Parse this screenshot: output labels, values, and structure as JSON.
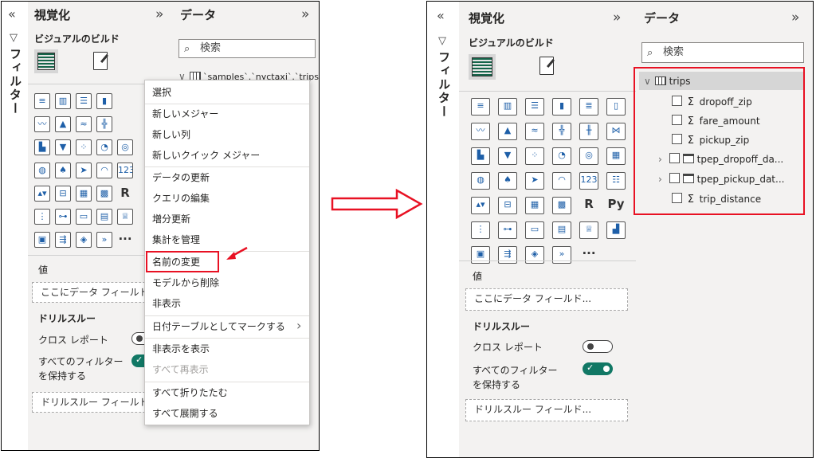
{
  "left_shot": {
    "collapse_icon": "«",
    "filter_vertical_label": "フィルター",
    "filter_icon": "funnel-icon",
    "visual_pane": {
      "title": "視覚化",
      "expand_icon": "»",
      "build_label": "ビジュアルのビルド",
      "values_label": "値",
      "values_placeholder": "ここにデータ フィールド",
      "drillthrough_label": "ドリルスルー",
      "cross_report_label": "クロス レポート",
      "keep_filters_line1": "すべてのフィルター",
      "keep_filters_line2": "を保持する",
      "drill_fields_placeholder": "ドリルスルー フィールド"
    },
    "data_pane": {
      "title": "データ",
      "expand_icon": "»",
      "search_placeholder": "検索",
      "table_path": "`samples`.`nyctaxi`.`trips`"
    },
    "context_menu": {
      "items": [
        "選択",
        "新しいメジャー",
        "新しい列",
        "新しいクイック メジャー",
        "データの更新",
        "クエリの編集",
        "増分更新",
        "集計を管理",
        "名前の変更",
        "モデルから削除",
        "非表示",
        "日付テーブルとしてマークする",
        "非表示を表示",
        "すべて再表示",
        "すべて折りたたむ",
        "すべて展開する"
      ],
      "submenu_arrow": "›",
      "highlighted_item": "名前の変更",
      "highlight_color": "#e81123"
    }
  },
  "arrow": {
    "icon": "right-arrow-icon",
    "color": "#e81123"
  },
  "right_shot": {
    "collapse_icon": "«",
    "filter_vertical_label": "フィルター",
    "visual_pane": {
      "title": "視覚化",
      "expand_icon": "»",
      "build_label": "ビジュアルのビルド",
      "values_label": "値",
      "values_placeholder": "ここにデータ フィールド...",
      "drillthrough_label": "ドリルスルー",
      "cross_report_label": "クロス レポート",
      "keep_filters_line1": "すべてのフィルター",
      "keep_filters_line2": "を保持する",
      "drill_fields_placeholder": "ドリルスルー フィールド..."
    },
    "data_pane": {
      "title": "データ",
      "expand_icon": "»",
      "search_placeholder": "検索",
      "table_name": "trips",
      "fields": [
        {
          "name": "dropoff_zip",
          "kind": "sum"
        },
        {
          "name": "fare_amount",
          "kind": "sum"
        },
        {
          "name": "pickup_zip",
          "kind": "sum"
        },
        {
          "name": "tpep_dropoff_da...",
          "kind": "date"
        },
        {
          "name": "tpep_pickup_dat...",
          "kind": "date"
        },
        {
          "name": "trip_distance",
          "kind": "sum"
        }
      ]
    }
  },
  "colors": {
    "toggle_on": "#117865",
    "accent_red": "#e81123",
    "pane_bg": "#f3f2f1"
  },
  "visual_icons": [
    "stacked-bar-icon",
    "stacked-column-icon",
    "clustered-bar-icon",
    "clustered-column-icon",
    "100-bar-icon",
    "100-column-icon",
    "line-chart-icon",
    "area-chart-icon",
    "stacked-area-icon",
    "line-column-icon",
    "line-clustered-icon",
    "ribbon-chart-icon",
    "waterfall-icon",
    "funnel-chart-icon",
    "scatter-icon",
    "pie-chart-icon",
    "donut-chart-icon",
    "treemap-icon",
    "map-icon",
    "filled-map-icon",
    "azure-map-icon",
    "gauge-icon",
    "card-icon",
    "multi-row-card-icon",
    "kpi-icon",
    "slicer-icon",
    "table-icon",
    "matrix-icon",
    "r-visual-icon",
    "python-visual-icon",
    "key-influencers-icon",
    "decomposition-tree-icon",
    "qa-icon",
    "narrative-icon",
    "goals-icon",
    "paginated-report-icon",
    "power-apps-icon",
    "power-automate-icon",
    "diamond-visual-icon",
    "chevron-visual-icon",
    "more-visuals-icon"
  ]
}
